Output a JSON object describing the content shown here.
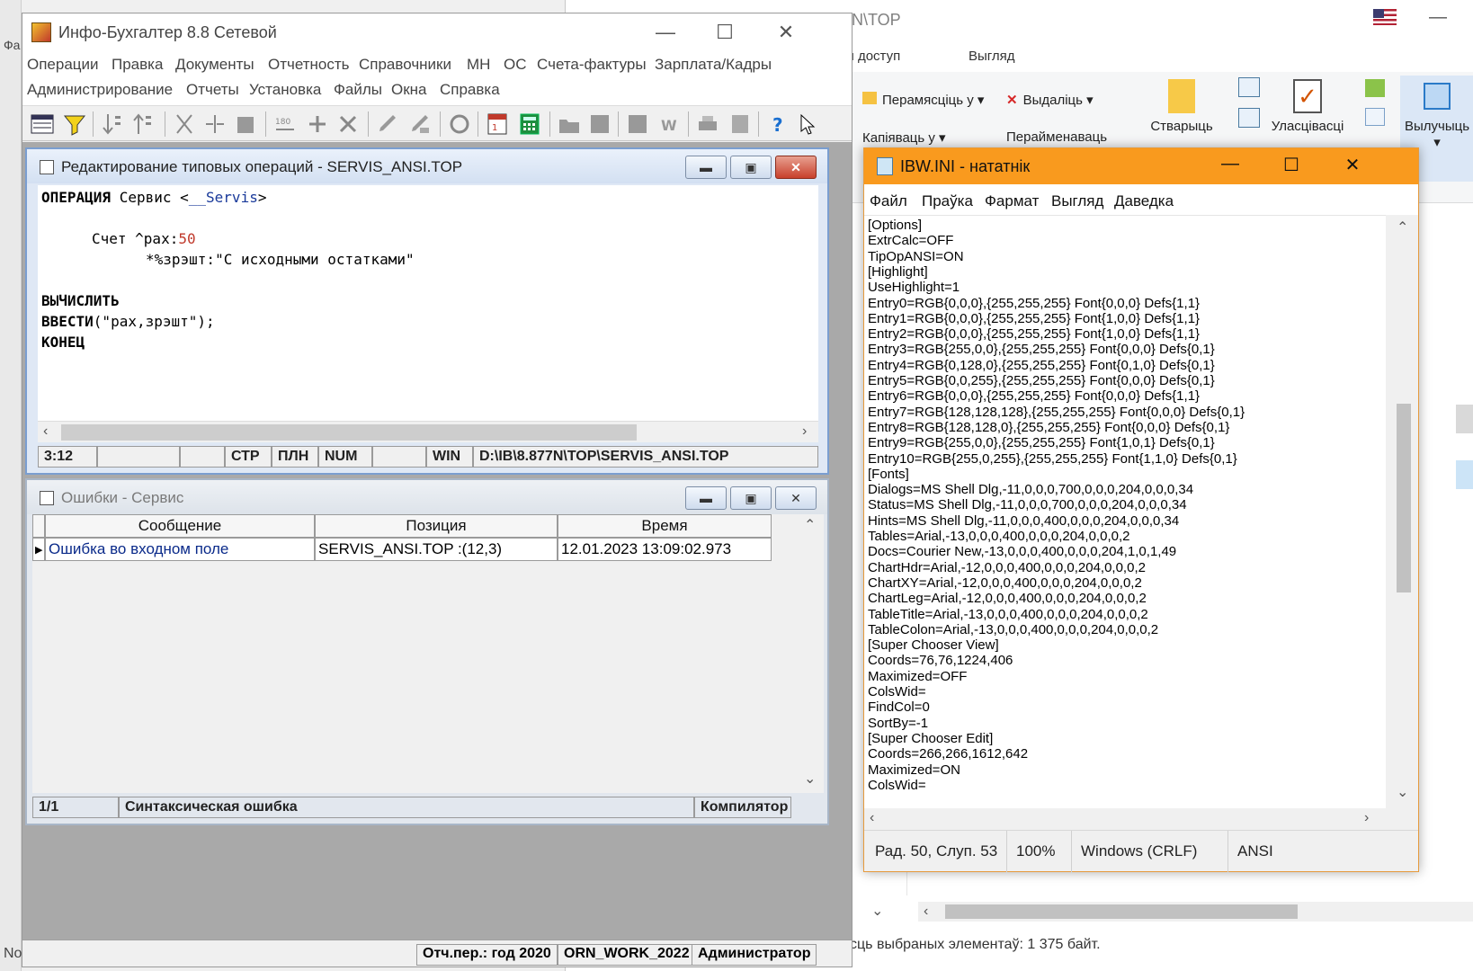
{
  "explorer": {
    "title": "N\\TOP",
    "tabs": [
      "ы доступ",
      "Выгляд"
    ],
    "ribbon": {
      "move": "Перамясціць у",
      "delete": "Выдаліць",
      "copy": "Капіяваць у",
      "rename": "Перайменаваць",
      "create": "Стварыць",
      "properties": "Уласцівасці",
      "select": "Вылучыць"
    },
    "status": "сць выбраных элементаў: 1  375 байт."
  },
  "left_strip": {
    "label_top": "Фа",
    "label_bottom": "No"
  },
  "app": {
    "title": "Инфо-Бухгалтер 8.8 Сетевой",
    "menu_row1": [
      "Операции",
      "Правка",
      "Документы",
      "Отчетность",
      "Справочники",
      "МН",
      "ОС",
      "Счета-фактуры",
      "Зарплата/Кадры"
    ],
    "menu_row2": [
      "Администрирование",
      "Отчеты",
      "Установка",
      "Файлы",
      "Окна",
      "Справка"
    ],
    "status": [
      "Отч.пер.: год 2020",
      "ORN_WORK_2022",
      "Администратор"
    ]
  },
  "editor": {
    "title": "Редактирование типовых операций - SERVIS_ANSI.TOP",
    "code": {
      "l1_kw": "ОПЕРАЦИЯ",
      "l1_txt": " Сервис <",
      "l1_link": "__Servis",
      "l1_end": ">",
      "l3_txt": "Счет ^рах:",
      "l3_num": "50",
      "l4_txt": "*%зрэшт:\"С исходными остатками\"",
      "l6_kw": "ВЫЧИСЛИТЬ",
      "l7_kw": "ВВЕСТИ",
      "l7_txt": "(\"рах,зрэшт\");",
      "l8_kw": "КОНЕЦ"
    },
    "status": [
      "3:12",
      "",
      "",
      "СТР",
      "ПЛН",
      "NUM",
      "",
      "WIN",
      "D:\\IB\\8.877N\\TOP\\SERVIS_ANSI.TOP"
    ]
  },
  "errors": {
    "title": "Ошибки - Сервис",
    "columns": [
      "Сообщение",
      "Позиция",
      "Время"
    ],
    "rows": [
      {
        "message": "Ошибка во входном поле",
        "position": "SERVIS_ANSI.TOP :(12,3)",
        "time": "12.01.2023 13:09:02.973"
      }
    ],
    "status": [
      "1/1",
      "Синтаксическая ошибка",
      "Компилятор"
    ]
  },
  "notepad": {
    "title": "IBW.INI - нататнік",
    "menu": [
      "Файл",
      "Праўка",
      "Фармат",
      "Выгляд",
      "Даведка"
    ],
    "lines": [
      "[Options]",
      "ExtrCalc=OFF",
      "TipOpANSI=ON",
      "[Highlight]",
      "UseHighlight=1",
      "Entry0=RGB{0,0,0},{255,255,255} Font{0,0,0} Defs{1,1}",
      "Entry1=RGB{0,0,0},{255,255,255} Font{1,0,0} Defs{1,1}",
      "Entry2=RGB{0,0,0},{255,255,255} Font{1,0,0} Defs{1,1}",
      "Entry3=RGB{255,0,0},{255,255,255} Font{0,0,0} Defs{0,1}",
      "Entry4=RGB{0,128,0},{255,255,255} Font{0,1,0} Defs{0,1}",
      "Entry5=RGB{0,0,255},{255,255,255} Font{0,0,0} Defs{0,1}",
      "Entry6=RGB{0,0,0},{255,255,255} Font{0,0,0} Defs{1,1}",
      "Entry7=RGB{128,128,128},{255,255,255} Font{0,0,0} Defs{0,1}",
      "Entry8=RGB{128,128,0},{255,255,255} Font{0,0,0} Defs{0,1}",
      "Entry9=RGB{255,0,0},{255,255,255} Font{1,0,1} Defs{0,1}",
      "Entry10=RGB{255,0,255},{255,255,255} Font{1,1,0} Defs{0,1}",
      "[Fonts]",
      "Dialogs=MS Shell Dlg,-11,0,0,0,700,0,0,0,204,0,0,0,34",
      "Status=MS Shell Dlg,-11,0,0,0,700,0,0,0,204,0,0,0,34",
      "Hints=MS Shell Dlg,-11,0,0,0,400,0,0,0,204,0,0,0,34",
      "Tables=Arial,-13,0,0,0,400,0,0,0,204,0,0,0,2",
      "Docs=Courier New,-13,0,0,0,400,0,0,0,204,1,0,1,49",
      "ChartHdr=Arial,-12,0,0,0,400,0,0,0,204,0,0,0,2",
      "ChartXY=Arial,-12,0,0,0,400,0,0,0,204,0,0,0,2",
      "ChartLeg=Arial,-12,0,0,0,400,0,0,0,204,0,0,0,2",
      "TableTitle=Arial,-13,0,0,0,400,0,0,0,204,0,0,0,2",
      "TableColon=Arial,-13,0,0,0,400,0,0,0,204,0,0,0,2",
      "[Super Chooser View]",
      "Coords=76,76,1224,406",
      "Maximized=OFF",
      "ColsWid=",
      "FindCol=0",
      "SortBy=-1",
      "[Super Chooser Edit]",
      "Coords=266,266,1612,642",
      "Maximized=ON",
      "ColsWid="
    ],
    "status": [
      "Рад. 50, Слуп. 53",
      "100%",
      "Windows (CRLF)",
      "ANSI"
    ]
  },
  "colors": {
    "notepad_title": "#f99a1e",
    "mdi_bg": "#a9a9a9",
    "child_border": "#7a9ed0",
    "close_red": "#c8402c"
  }
}
